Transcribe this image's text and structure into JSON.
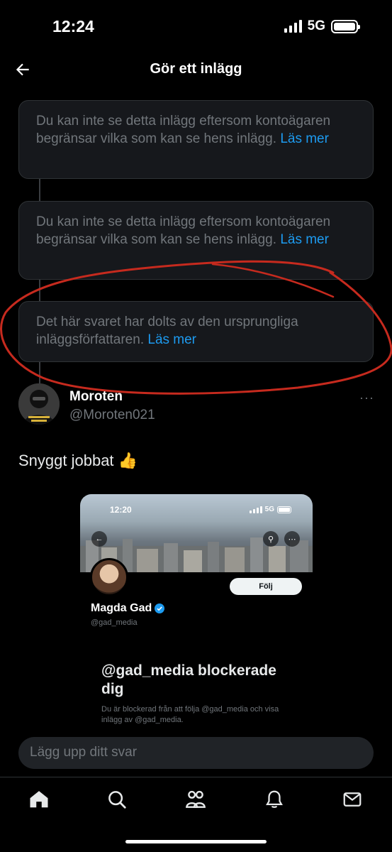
{
  "status_bar": {
    "time": "12:24",
    "network": "5G"
  },
  "header": {
    "title": "Gör ett inlägg"
  },
  "notices": [
    {
      "text": "Du kan inte se detta inlägg eftersom kontoägaren begränsar vilka som kan se hens inlägg.",
      "link": "Läs mer"
    },
    {
      "text": "Du kan inte se detta inlägg eftersom kontoägaren begränsar vilka som kan se hens inlägg.",
      "link": "Läs mer"
    },
    {
      "text": "Det här svaret har dolts av den ursprungliga inläggsförfattaren.",
      "link": "Läs mer"
    }
  ],
  "post": {
    "name": "Moroten",
    "handle": "@Moroten021",
    "more": "···",
    "text": "Snyggt jobbat 👍"
  },
  "media": {
    "time": "12:20",
    "network": "5G",
    "follow_label": "Följ",
    "profile_name": "Magda Gad",
    "profile_handle": "@gad_media",
    "block_title": "@gad_media blockerade dig",
    "block_desc": "Du är blockerad från att följa @gad_media och visa inlägg av @gad_media."
  },
  "reply": {
    "placeholder": "Lägg upp ditt svar"
  },
  "tabs": [
    "home-icon",
    "search-icon",
    "communities-icon",
    "notifications-icon",
    "messages-icon"
  ],
  "colors": {
    "link": "#1d9bf0",
    "annotation": "#c62a1e",
    "verified": "#1d9bf0"
  }
}
